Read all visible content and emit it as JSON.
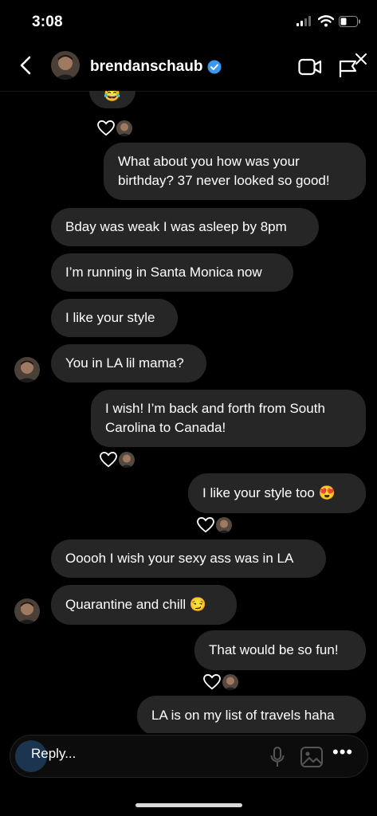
{
  "status_bar": {
    "time": "3:08"
  },
  "header": {
    "username": "brendanschaub"
  },
  "messages": [
    {
      "text": "😂"
    },
    {
      "text": "What about you how was your birthday? 37 never looked so good!"
    },
    {
      "text": "Bday was weak I was asleep by 8pm"
    },
    {
      "text": "I’m running in Santa Monica now"
    },
    {
      "text": "I like your style"
    },
    {
      "text": "You in LA lil mama?"
    },
    {
      "text": "I wish! I’m back and forth from South Carolina to Canada!"
    },
    {
      "text": "I like your style too 😍"
    },
    {
      "text": "Ooooh I wish your sexy ass was in LA"
    },
    {
      "text": "Quarantine and chill 😏"
    },
    {
      "text": "That would be so fun!"
    },
    {
      "text": "LA is on my list of travels haha"
    }
  ],
  "composer": {
    "reply_label": "Reply...",
    "more_label": "•••"
  },
  "colors": {
    "background": "#000000",
    "bubble": "#262626",
    "verified": "#3897f0"
  },
  "icons": [
    "back-chevron-icon",
    "verified-badge-icon",
    "video-call-icon",
    "flag-icon",
    "heart-icon",
    "microphone-icon",
    "gallery-icon",
    "more-icon"
  ]
}
